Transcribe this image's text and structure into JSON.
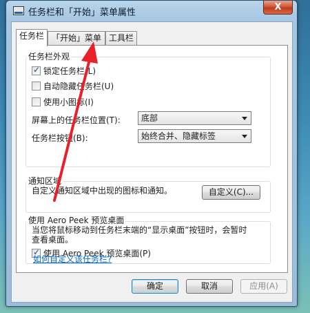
{
  "window": {
    "title": "任务栏和「开始」菜单属性",
    "close_label": "X"
  },
  "tabs": [
    {
      "label": "任务栏",
      "active": true
    },
    {
      "label": "「开始」菜单",
      "active": false
    },
    {
      "label": "工具栏",
      "active": false
    }
  ],
  "appearance": {
    "group_title": "任务栏外观",
    "lock_label": "锁定任务栏(L)",
    "lock_checked": true,
    "autohide_label": "自动隐藏任务栏(U)",
    "autohide_checked": false,
    "small_icons_label": "使用小图标(I)",
    "small_icons_checked": false,
    "position_label": "屏幕上的任务栏位置(T):",
    "position_value": "底部",
    "buttons_label": "任务栏按钮(B):",
    "buttons_value": "始终合并、隐藏标签"
  },
  "notification": {
    "group_title": "通知区域",
    "description": "自定义通知区域中出现的图标和通知。",
    "customize_button": "自定义(C)..."
  },
  "aero_peek": {
    "group_title": "使用 Aero Peek 预览桌面",
    "description_line1": "当您将鼠标移动到任务栏末端的“显示桌面”按钮时，会暂时",
    "description_line2": "查看桌面。",
    "checkbox_label": "使用 Aero Peek 预览桌面(P)",
    "checked": true
  },
  "help_link": "如何自定义该任务栏?",
  "footer": {
    "ok": "确定",
    "cancel": "取消",
    "apply": "应用(A)"
  },
  "annotation": {
    "color": "#e8202a"
  }
}
